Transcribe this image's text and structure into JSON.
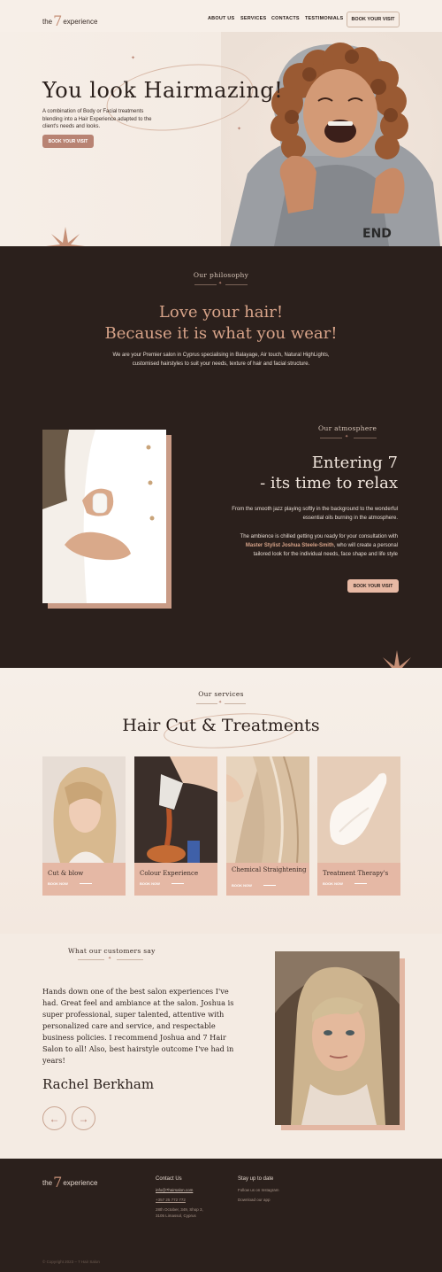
{
  "header": {
    "logo_pre": "the",
    "logo_num": "7",
    "logo_post": "experience",
    "nav": [
      "ABOUT US",
      "SERVICES",
      "CONTACTS",
      "TESTIMONIALS"
    ],
    "cta": "BOOK YOUR VISIT"
  },
  "hero": {
    "title": "You look Hairmazing!",
    "description": "A combination of Body or Facial treatments blending into a Hair Experience adapted to the client's needs and looks.",
    "cta": "BOOK YOUR VISIT",
    "hoodie_text": "END"
  },
  "philosophy": {
    "eyebrow": "Our philosophy",
    "heading_line1": "Love your hair!",
    "heading_line2": "Because it is what you wear!",
    "body": "We are your Premier salon in Cyprus specialising in Balayage, Air touch, Natural HighLights, customised hairstyles to suit your needs, texture of hair and facial structure."
  },
  "atmosphere": {
    "eyebrow": "Our atmosphere",
    "heading_line1": "Entering 7",
    "heading_line2": "- its time to relax",
    "para1": "From the smooth jazz playing softly in the background to the wonderful essential oils burning in the atmosphere.",
    "para2_pre": "The ambience is chilled getting you ready for your consultation with ",
    "para2_highlight": "Master Stylist Joshua Steele-Smith",
    "para2_post": ", who will create a personal tailored look for the individual needs, face shape and life style",
    "cta": "BOOK YOUR VISIT"
  },
  "services": {
    "eyebrow": "Our services",
    "heading": "Hair Cut & Treatments",
    "cards": [
      {
        "name": "Cut & blow",
        "book": "BOOK NOW"
      },
      {
        "name": "Colour Experience",
        "book": "BOOK NOW"
      },
      {
        "name": "Chemical Straightening",
        "book": "BOOK NOW"
      },
      {
        "name": "Treatment Therapy's",
        "book": "BOOK NOW"
      }
    ]
  },
  "testimonial": {
    "eyebrow": "What our customers say",
    "quote": "Hands down one of the best salon experiences I've had. Great feel and ambiance at the salon. Joshua is super professional, super talented, attentive with personalized care and service, and respectable business policies. I recommend Joshua and 7 Hair Salon to all! Also, best hairstyle outcome I've had in years!",
    "author": "Rachel Berkham",
    "prev": "←",
    "next": "→"
  },
  "footer": {
    "logo_pre": "the",
    "logo_num": "7",
    "logo_post": "experience",
    "contact_title": "Contact Us",
    "email": "info@7hairsalon.com",
    "phone": "+357 25 772 772",
    "address1": "28th October, 349, Shop 3,",
    "address2": "3105 Limassol, Cyprus",
    "follow_title": "Stay up to date",
    "instagram": "Follow us on Instagram",
    "app": "Download our app",
    "copyright": "© Copyright 2023 – 7 Hair Salon"
  },
  "colors": {
    "dark_bg": "#2b201c",
    "accent": "#b88373",
    "peach": "#e5b8a5",
    "cream": "#f5ede5"
  }
}
